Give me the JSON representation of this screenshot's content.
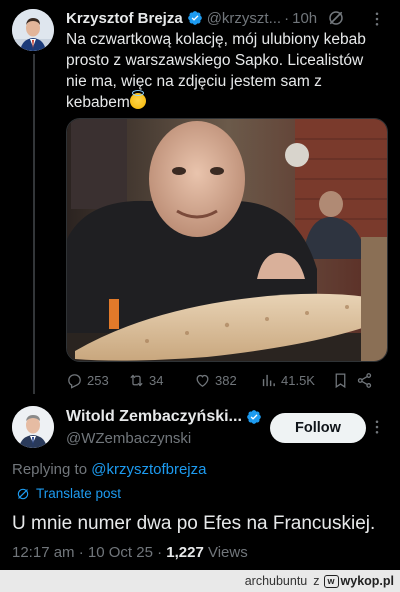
{
  "tweet1": {
    "author_name": "Krzysztof Brejza",
    "handle": "@krzyszt...",
    "time": "10h",
    "text_lines": [
      "Na czwartkową kolację, mój ulubiony kebab",
      "prosto z warszawskiego Sapko. Licealistów",
      "nie ma, więc na zdjęciu jestem sam z",
      "kebabem"
    ],
    "emoji": "smiling-face-with-halo",
    "actions": {
      "replies": "253",
      "retweets": "34",
      "likes": "382",
      "views": "41.5K"
    }
  },
  "tweet2": {
    "author_name": "Witold Zembaczyński...",
    "handle": "@WZembaczynski",
    "follow_label": "Follow",
    "replying_prefix": "Replying to",
    "replying_to": "@krzysztofbrejza",
    "translate_label": "Translate post",
    "text": "U mnie numer dwa po Efes na Francuskiej.",
    "time": "12:17 am · 10 Oct 25 · ",
    "views_count": "1,227",
    "views_label": " Views"
  },
  "footer": {
    "user": "archubuntu",
    "z": "z",
    "site": "wykop.pl",
    "logo_letter": "w"
  },
  "colors": {
    "background": "#000000",
    "accent": "#1d9bf0",
    "muted": "#71767b",
    "text": "#e7e9ea"
  }
}
